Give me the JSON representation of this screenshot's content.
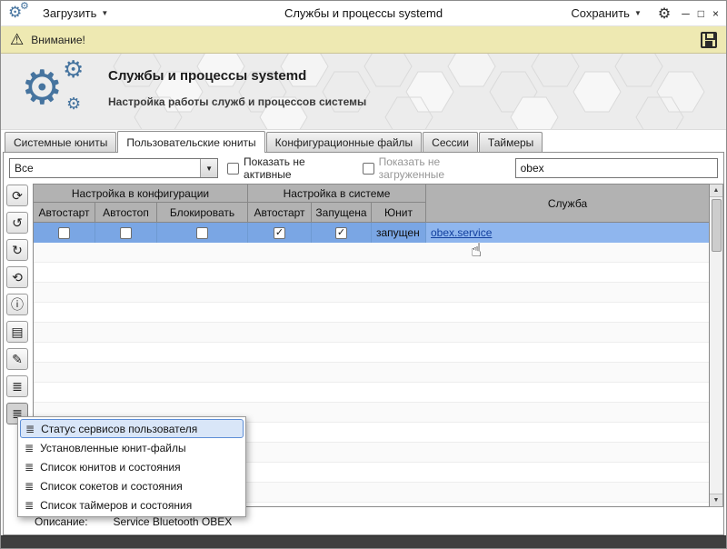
{
  "icons": {
    "gear": "⚙",
    "dropdown": "▼",
    "minimize": "─",
    "maximize": "□",
    "close": "×",
    "warning": "⚠",
    "refresh": "⟳",
    "reload": "↺",
    "redo": "↻",
    "undo": "⟲",
    "info": "ⓘ",
    "document": "▤",
    "edit": "✎",
    "list": "≣",
    "menu_item": "≣",
    "scroll_up": "▲",
    "scroll_down": "▼",
    "check": "✓",
    "cursor": "☝"
  },
  "colors": {
    "selection": "#7aa6e4",
    "link": "#123f9e",
    "warning_bg": "#eee9b2",
    "gear_accent": "#46749f",
    "header_gray": "#b2b2b2"
  },
  "titlebar": {
    "load_label": "Загрузить",
    "title": "Службы и процессы systemd",
    "save_label": "Сохранить"
  },
  "warning_bar": {
    "text": "Внимание!"
  },
  "banner": {
    "title": "Службы и процессы systemd",
    "subtitle": "Настройка работы служб и процессов системы"
  },
  "tabs": [
    {
      "label": "Системные юниты"
    },
    {
      "label": "Пользовательские юниты"
    },
    {
      "label": "Конфигурационные файлы"
    },
    {
      "label": "Сессии"
    },
    {
      "label": "Таймеры"
    }
  ],
  "filters": {
    "combo_value": "Все",
    "show_inactive_label": "Показать не активные",
    "show_inactive_checked": false,
    "show_unloaded_label": "Показать не загруженные",
    "show_unloaded_checked": false,
    "search_value": "obex"
  },
  "table": {
    "group_headers": {
      "config": "Настройка в конфигурации",
      "system": "Настройка в системе",
      "service": "Служба"
    },
    "columns": [
      {
        "label": "Автостарт"
      },
      {
        "label": "Автостоп"
      },
      {
        "label": "Блокировать"
      },
      {
        "label": "Автостарт"
      },
      {
        "label": "Запущена"
      },
      {
        "label": "Юнит"
      }
    ],
    "selected_row": {
      "autostart_config": false,
      "autostop": false,
      "block": false,
      "autostart_system": true,
      "running": true,
      "unit_state": "запущен",
      "service": "obex.service"
    }
  },
  "context_menu": {
    "items": [
      {
        "label": "Статус сервисов пользователя"
      },
      {
        "label": "Установленные юнит-файлы"
      },
      {
        "label": "Список юнитов и состояния"
      },
      {
        "label": "Список сокетов и состояния"
      },
      {
        "label": "Список таймеров и состояния"
      }
    ]
  },
  "status": {
    "label": "Описание:",
    "value": "Service Bluetooth OBEX"
  }
}
